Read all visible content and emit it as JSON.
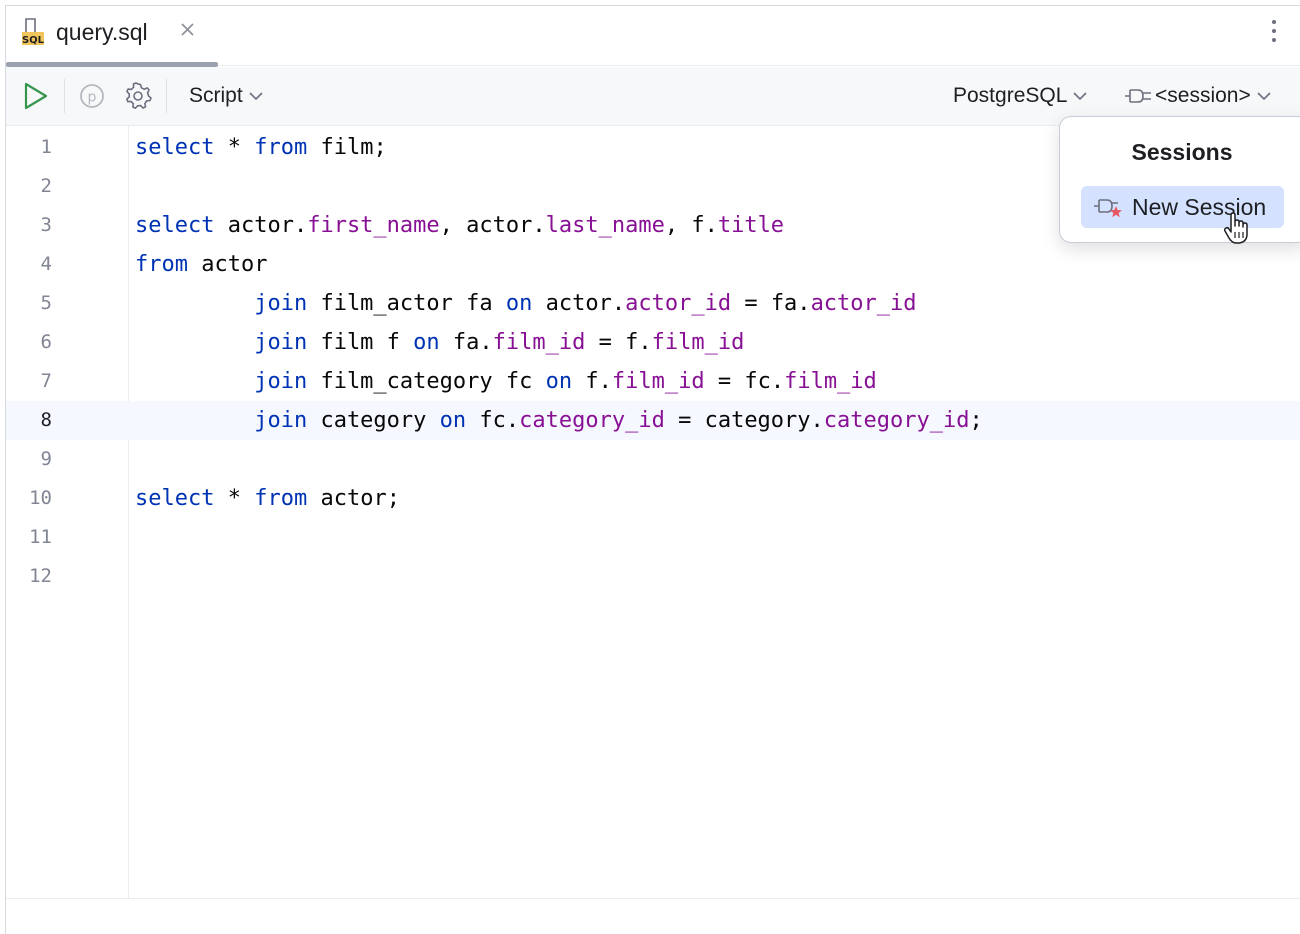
{
  "tab": {
    "title": "query.sql",
    "icon": "sql-file-icon",
    "icon_label": "SQL"
  },
  "toolbar": {
    "run_icon": "run-icon",
    "params_icon": "parameters-icon",
    "settings_icon": "gear-icon",
    "script_label": "Script",
    "dialect_label": "PostgreSQL",
    "session_label": "<session>"
  },
  "editor": {
    "current_line": 8,
    "lines": [
      {
        "n": "1",
        "tokens": [
          [
            "kw",
            "select"
          ],
          [
            "t",
            " * "
          ],
          [
            "kw",
            "from"
          ],
          [
            "t",
            " film;"
          ]
        ]
      },
      {
        "n": "2",
        "tokens": []
      },
      {
        "n": "3",
        "tokens": [
          [
            "kw",
            "select"
          ],
          [
            "t",
            " actor."
          ],
          [
            "f",
            "first_name"
          ],
          [
            "t",
            ", actor."
          ],
          [
            "f",
            "last_name"
          ],
          [
            "t",
            ", f."
          ],
          [
            "f",
            "title"
          ]
        ]
      },
      {
        "n": "4",
        "tokens": [
          [
            "kw",
            "from"
          ],
          [
            "t",
            " actor"
          ]
        ]
      },
      {
        "n": "5",
        "tokens": [
          [
            "t",
            "         "
          ],
          [
            "kw",
            "join"
          ],
          [
            "t",
            " film_actor fa "
          ],
          [
            "kw",
            "on"
          ],
          [
            "t",
            " actor."
          ],
          [
            "f",
            "actor_id"
          ],
          [
            "t",
            " = fa."
          ],
          [
            "f",
            "actor_id"
          ]
        ]
      },
      {
        "n": "6",
        "tokens": [
          [
            "t",
            "         "
          ],
          [
            "kw",
            "join"
          ],
          [
            "t",
            " film f "
          ],
          [
            "kw",
            "on"
          ],
          [
            "t",
            " fa."
          ],
          [
            "f",
            "film_id"
          ],
          [
            "t",
            " = f."
          ],
          [
            "f",
            "film_id"
          ]
        ]
      },
      {
        "n": "7",
        "tokens": [
          [
            "t",
            "         "
          ],
          [
            "kw",
            "join"
          ],
          [
            "t",
            " film_category fc "
          ],
          [
            "kw",
            "on"
          ],
          [
            "t",
            " f."
          ],
          [
            "f",
            "film_id"
          ],
          [
            "t",
            " = fc."
          ],
          [
            "f",
            "film_id"
          ]
        ]
      },
      {
        "n": "8",
        "tokens": [
          [
            "t",
            "         "
          ],
          [
            "kw",
            "join"
          ],
          [
            "t",
            " category "
          ],
          [
            "kw",
            "on"
          ],
          [
            "t",
            " fc."
          ],
          [
            "f",
            "category_id"
          ],
          [
            "t",
            " = category."
          ],
          [
            "f",
            "category_id"
          ],
          [
            "t",
            ";"
          ]
        ]
      },
      {
        "n": "9",
        "tokens": []
      },
      {
        "n": "10",
        "tokens": [
          [
            "kw",
            "select"
          ],
          [
            "t",
            " * "
          ],
          [
            "kw",
            "from"
          ],
          [
            "t",
            " actor;"
          ]
        ]
      },
      {
        "n": "11",
        "tokens": []
      },
      {
        "n": "12",
        "tokens": []
      }
    ]
  },
  "popup": {
    "title": "Sessions",
    "items": [
      {
        "label": "New Session",
        "icon": "new-session-icon",
        "selected": true
      }
    ]
  },
  "colors": {
    "keyword": "#0033b3",
    "field": "#871094",
    "text": "#080808",
    "selection": "#d4e2ff",
    "run_green": "#369650"
  }
}
